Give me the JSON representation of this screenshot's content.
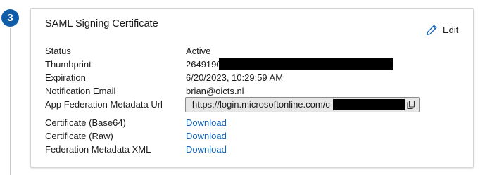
{
  "step": {
    "number": "3"
  },
  "card": {
    "title": "SAML Signing Certificate",
    "edit_label": "Edit"
  },
  "rows": {
    "status": {
      "label": "Status",
      "value": "Active"
    },
    "thumbprint": {
      "label": "Thumbprint",
      "value": "2649190"
    },
    "expiration": {
      "label": "Expiration",
      "value": "6/20/2023, 10:29:59 AM"
    },
    "notification_email": {
      "label": "Notification Email",
      "value": "brian@oicts.nl"
    },
    "metadata_url": {
      "label": "App Federation Metadata Url",
      "value": "https://login.microsoftonline.com/c"
    },
    "cert_base64": {
      "label": "Certificate (Base64)",
      "link": "Download"
    },
    "cert_raw": {
      "label": "Certificate (Raw)",
      "link": "Download"
    },
    "federation_xml": {
      "label": "Federation Metadata XML",
      "link": "Download"
    }
  },
  "colors": {
    "step_badge": "#0f5da8",
    "link": "#0f62b8",
    "edit_icon": "#0f62b8"
  },
  "icons": {
    "edit": "pencil-icon",
    "copy": "copy-icon"
  }
}
